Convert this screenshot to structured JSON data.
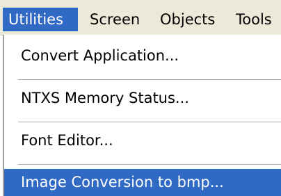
{
  "menubar": {
    "items": [
      {
        "label": "Utilities",
        "active": true
      },
      {
        "label": "Screen",
        "active": false
      },
      {
        "label": "Objects",
        "active": false
      },
      {
        "label": "Tools",
        "active": false
      }
    ]
  },
  "dropdown": {
    "items": [
      {
        "label": "Convert Application..."
      },
      {
        "label": "NTXS Memory Status..."
      },
      {
        "label": "Font Editor..."
      },
      {
        "label": "Image Conversion to bmp...",
        "highlighted": true
      }
    ]
  },
  "colors": {
    "menubar_bg": "#ece9d8",
    "highlight": "#316ac5",
    "highlight_text": "#ffffff",
    "separator": "#aca899"
  }
}
